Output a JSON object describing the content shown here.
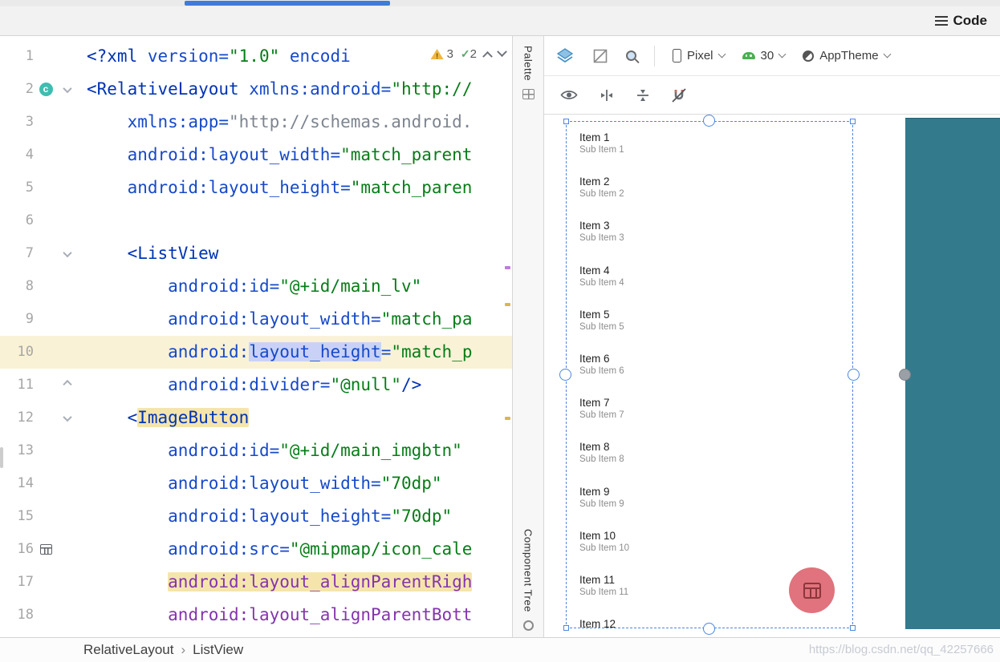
{
  "window": {
    "code_mode_label": "Code",
    "watermark": "https://blog.csdn.net/qq_42257666"
  },
  "editor": {
    "inspection": {
      "warnings": "3",
      "typos": "2"
    },
    "lines": [
      {
        "n": "1",
        "segs": [
          [
            "t",
            "<?xml "
          ],
          [
            "a",
            "version="
          ],
          [
            "v",
            "\"1.0\" "
          ],
          [
            "a",
            "encodi"
          ]
        ]
      },
      {
        "n": "2",
        "badge": "c",
        "fold": "down",
        "segs": [
          [
            "t",
            "<RelativeLayout "
          ],
          [
            "a",
            "xmlns:android="
          ],
          [
            "v",
            "\"http://"
          ]
        ]
      },
      {
        "n": "3",
        "segs": [
          [
            "pl",
            "    "
          ],
          [
            "a",
            "xmlns:app="
          ],
          [
            "g",
            "\"http://schemas.android."
          ]
        ]
      },
      {
        "n": "4",
        "segs": [
          [
            "pl",
            "    "
          ],
          [
            "a",
            "android:layout_width="
          ],
          [
            "v",
            "\"match_parent"
          ]
        ]
      },
      {
        "n": "5",
        "segs": [
          [
            "pl",
            "    "
          ],
          [
            "a",
            "android:layout_height="
          ],
          [
            "v",
            "\"match_paren"
          ]
        ]
      },
      {
        "n": "6",
        "segs": []
      },
      {
        "n": "7",
        "fold": "down",
        "segs": [
          [
            "pl",
            "    "
          ],
          [
            "t",
            "<ListView"
          ]
        ]
      },
      {
        "n": "8",
        "segs": [
          [
            "pl",
            "        "
          ],
          [
            "a",
            "android:id="
          ],
          [
            "v",
            "\"@+id/main_lv\""
          ]
        ]
      },
      {
        "n": "9",
        "segs": [
          [
            "pl",
            "        "
          ],
          [
            "a",
            "android:layout_width="
          ],
          [
            "v",
            "\"match_pa"
          ]
        ]
      },
      {
        "n": "10",
        "hl": true,
        "segs": [
          [
            "pl",
            "        "
          ],
          [
            "a",
            "android:"
          ],
          [
            "a",
            "layout_height",
            "lav"
          ],
          [
            "a",
            "="
          ],
          [
            "v",
            "\"match_p"
          ]
        ]
      },
      {
        "n": "11",
        "fold": "up",
        "segs": [
          [
            "pl",
            "        "
          ],
          [
            "a",
            "android:divider="
          ],
          [
            "v",
            "\"@null\""
          ],
          [
            "t",
            "/>"
          ]
        ]
      },
      {
        "n": "12",
        "fold": "down",
        "segs": [
          [
            "pl",
            "    "
          ],
          [
            "t",
            "<"
          ],
          [
            "t",
            "ImageButton",
            "tan"
          ]
        ]
      },
      {
        "n": "13",
        "segs": [
          [
            "pl",
            "        "
          ],
          [
            "a",
            "android:id="
          ],
          [
            "v",
            "\"@+id/main_imgbtn\""
          ]
        ]
      },
      {
        "n": "14",
        "segs": [
          [
            "pl",
            "        "
          ],
          [
            "a",
            "android:layout_width="
          ],
          [
            "v",
            "\"70dp\""
          ]
        ]
      },
      {
        "n": "15",
        "segs": [
          [
            "pl",
            "        "
          ],
          [
            "a",
            "android:layout_height="
          ],
          [
            "v",
            "\"70dp\""
          ]
        ]
      },
      {
        "n": "16",
        "icon": "calendar",
        "segs": [
          [
            "pl",
            "        "
          ],
          [
            "a",
            "android:src="
          ],
          [
            "v",
            "\"@mipmap/icon_cale"
          ]
        ]
      },
      {
        "n": "17",
        "segs": [
          [
            "pl",
            "        "
          ],
          [
            "p",
            "android:layout_alignParentRigh",
            "tan"
          ]
        ]
      },
      {
        "n": "18",
        "segs": [
          [
            "pl",
            "        "
          ],
          [
            "p",
            "android:layout_alignParentBott"
          ]
        ]
      }
    ]
  },
  "sidebar": {
    "palette_label": "Palette",
    "component_tree_label": "Component Tree"
  },
  "design": {
    "toolbar": {
      "device": "Pixel",
      "api_level": "30",
      "theme": "AppTheme"
    },
    "preview": {
      "list_items": [
        {
          "title": "Item 1",
          "subtitle": "Sub Item 1"
        },
        {
          "title": "Item 2",
          "subtitle": "Sub Item 2"
        },
        {
          "title": "Item 3",
          "subtitle": "Sub Item 3"
        },
        {
          "title": "Item 4",
          "subtitle": "Sub Item 4"
        },
        {
          "title": "Item 5",
          "subtitle": "Sub Item 5"
        },
        {
          "title": "Item 6",
          "subtitle": "Sub Item 6"
        },
        {
          "title": "Item 7",
          "subtitle": "Sub Item 7"
        },
        {
          "title": "Item 8",
          "subtitle": "Sub Item 8"
        },
        {
          "title": "Item 9",
          "subtitle": "Sub Item 9"
        },
        {
          "title": "Item 10",
          "subtitle": "Sub Item 10"
        },
        {
          "title": "Item 11",
          "subtitle": "Sub Item 11"
        },
        {
          "title": "Item 12"
        }
      ]
    }
  },
  "breadcrumb": {
    "items": [
      "RelativeLayout",
      "ListView"
    ],
    "separator": "›"
  },
  "colors": {
    "accent_blue": "#4d86e0",
    "teal_panel": "#337a8d",
    "fab_pink": "#e0737d",
    "progress_blue": "#3f7bd9"
  }
}
